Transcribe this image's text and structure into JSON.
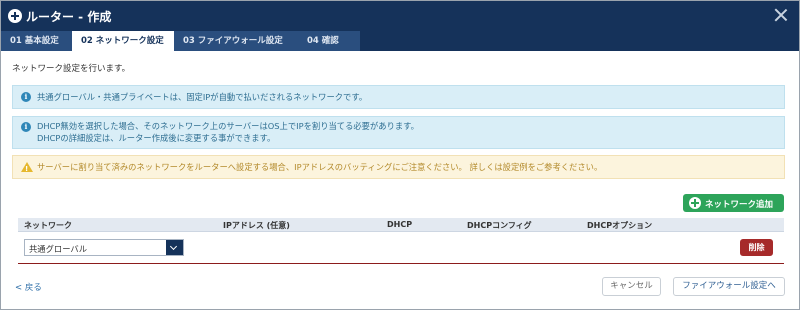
{
  "window": {
    "title": "ルーター - 作成",
    "title_icon": "plus-circle-icon",
    "close_icon": "close-icon"
  },
  "tabs": [
    {
      "label": "01 基本設定",
      "active": false
    },
    {
      "label": "02 ネットワーク設定",
      "active": true
    },
    {
      "label": "03 ファイアウォール設定",
      "active": false
    },
    {
      "label": "04 確認",
      "active": false
    }
  ],
  "intro_text": "ネットワーク設定を行います。",
  "alerts": {
    "info1": "共通グローバル・共通プライベートは、固定IPが自動で払いだされるネットワークです。",
    "info2_line1": "DHCP無効を選択した場合、そのネットワーク上のサーバーはOS上でIPを割り当てる必要があります。",
    "info2_line2": "DHCPの詳細設定は、ルーター作成後に変更する事ができます。",
    "warning": "サーバーに割り当て済みのネットワークをルーターへ設定する場合、IPアドレスのバッティングにご注意ください。 詳しくは設定例をご参考ください。"
  },
  "add_network_button": "ネットワーク追加",
  "table": {
    "columns": [
      "ネットワーク",
      "IPアドレス (任意)",
      "DHCP",
      "DHCPコンフィグ",
      "DHCPオプション"
    ],
    "rows": [
      {
        "network": "共通グローバル",
        "delete_label": "削除"
      }
    ]
  },
  "footer": {
    "back_link": "< 戻る",
    "cancel_button": "キャンセル",
    "next_button": "ファイアウォール設定へ"
  },
  "colors": {
    "header_bg": "#15325a",
    "info_bg": "#d9eef7",
    "warning_bg": "#fcf4dd",
    "add_button": "#2da45a",
    "delete_button": "#a62a2a"
  }
}
